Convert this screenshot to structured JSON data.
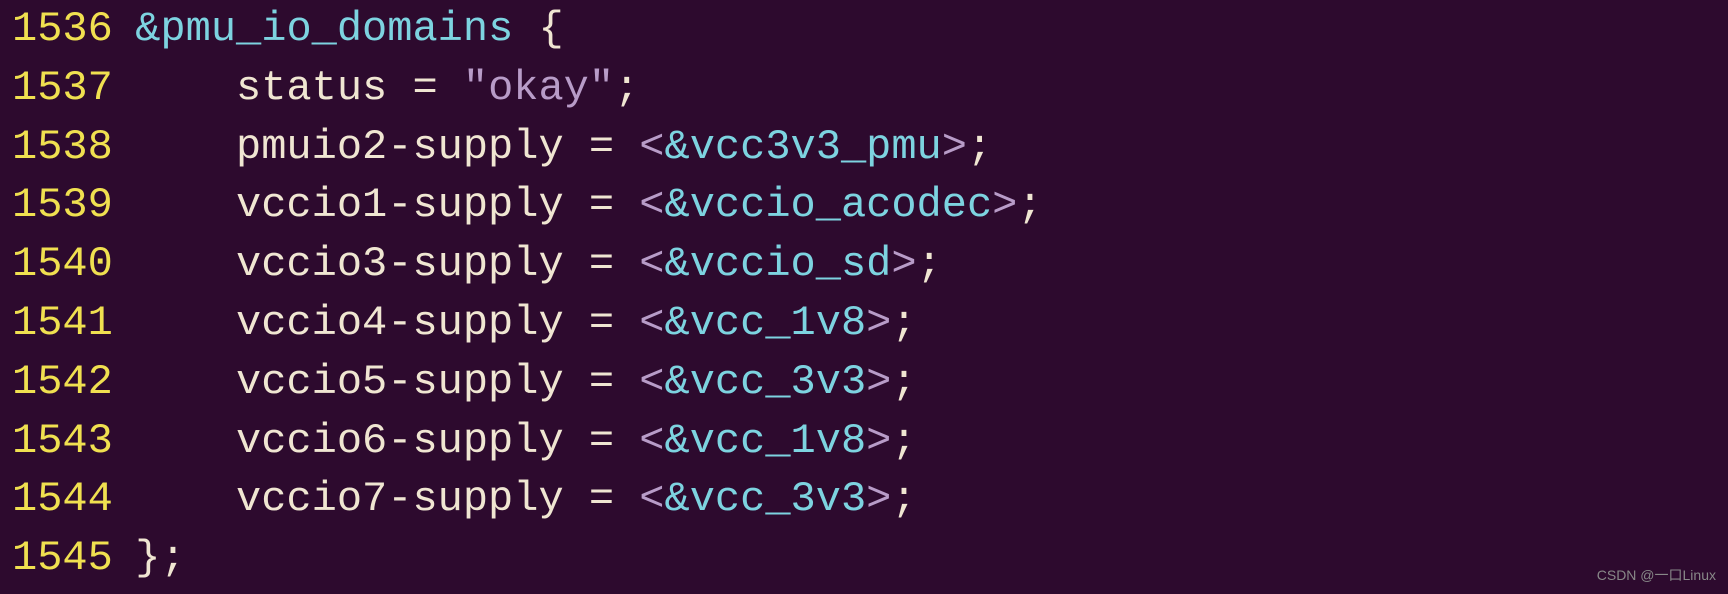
{
  "lines": [
    {
      "number": "1536",
      "tokens": [
        {
          "text": " ",
          "class": "token-default"
        },
        {
          "text": "&pmu_io_domains",
          "class": "token-identifier"
        },
        {
          "text": " {",
          "class": "token-default"
        }
      ]
    },
    {
      "number": "1537",
      "tokens": [
        {
          "text": "     status = ",
          "class": "token-default"
        },
        {
          "text": "\"okay\"",
          "class": "token-string"
        },
        {
          "text": ";",
          "class": "token-default"
        }
      ]
    },
    {
      "number": "1538",
      "tokens": [
        {
          "text": "     pmuio2-supply = ",
          "class": "token-default"
        },
        {
          "text": "<",
          "class": "token-angle"
        },
        {
          "text": "&vcc3v3_pmu",
          "class": "token-reference"
        },
        {
          "text": ">",
          "class": "token-angle"
        },
        {
          "text": ";",
          "class": "token-default"
        }
      ]
    },
    {
      "number": "1539",
      "tokens": [
        {
          "text": "     vccio1-supply = ",
          "class": "token-default"
        },
        {
          "text": "<",
          "class": "token-angle"
        },
        {
          "text": "&vccio_acodec",
          "class": "token-reference"
        },
        {
          "text": ">",
          "class": "token-angle"
        },
        {
          "text": ";",
          "class": "token-default"
        }
      ]
    },
    {
      "number": "1540",
      "tokens": [
        {
          "text": "     vccio3-supply = ",
          "class": "token-default"
        },
        {
          "text": "<",
          "class": "token-angle"
        },
        {
          "text": "&vccio_sd",
          "class": "token-reference"
        },
        {
          "text": ">",
          "class": "token-angle"
        },
        {
          "text": ";",
          "class": "token-default"
        }
      ]
    },
    {
      "number": "1541",
      "tokens": [
        {
          "text": "     vccio4-supply = ",
          "class": "token-default"
        },
        {
          "text": "<",
          "class": "token-angle"
        },
        {
          "text": "&vcc_1v8",
          "class": "token-reference"
        },
        {
          "text": ">",
          "class": "token-angle"
        },
        {
          "text": ";",
          "class": "token-default"
        }
      ]
    },
    {
      "number": "1542",
      "tokens": [
        {
          "text": "     vccio5-supply = ",
          "class": "token-default"
        },
        {
          "text": "<",
          "class": "token-angle"
        },
        {
          "text": "&vcc_3v3",
          "class": "token-reference"
        },
        {
          "text": ">",
          "class": "token-angle"
        },
        {
          "text": ";",
          "class": "token-default"
        }
      ]
    },
    {
      "number": "1543",
      "tokens": [
        {
          "text": "     vccio6-supply = ",
          "class": "token-default"
        },
        {
          "text": "<",
          "class": "token-angle"
        },
        {
          "text": "&vcc_1v8",
          "class": "token-reference"
        },
        {
          "text": ">",
          "class": "token-angle"
        },
        {
          "text": ";",
          "class": "token-default"
        }
      ]
    },
    {
      "number": "1544",
      "tokens": [
        {
          "text": "     vccio7-supply = ",
          "class": "token-default"
        },
        {
          "text": "<",
          "class": "token-angle"
        },
        {
          "text": "&vcc_3v3",
          "class": "token-reference"
        },
        {
          "text": ">",
          "class": "token-angle"
        },
        {
          "text": ";",
          "class": "token-default"
        }
      ]
    },
    {
      "number": "1545",
      "tokens": [
        {
          "text": " };",
          "class": "token-default"
        }
      ]
    }
  ],
  "watermark": "CSDN @一口Linux"
}
